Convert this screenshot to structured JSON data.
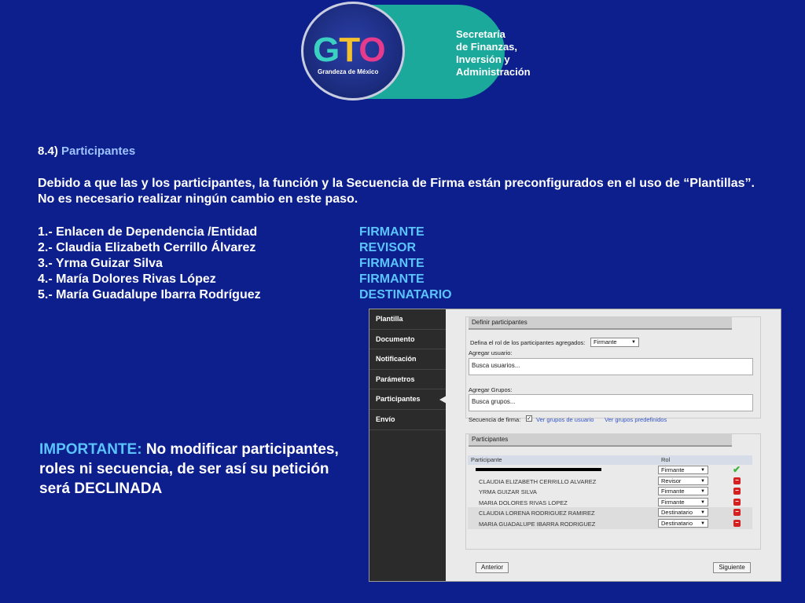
{
  "logo": {
    "mark": "GTO",
    "tagline": "Grandeza de México",
    "org_lines": [
      "Secretaría",
      "de Finanzas,",
      "Inversión y",
      "Administración"
    ]
  },
  "section": {
    "number": "8.4)",
    "title": "Participantes"
  },
  "paragraph": "Debido a que las y los participantes, la función y la Secuencia de Firma están preconfigurados en el uso de “Plantillas”. No es necesario realizar ningún cambio en este paso.",
  "participants_list": [
    {
      "name": "1.- Enlacen de Dependencia /Entidad",
      "role": "FIRMANTE"
    },
    {
      "name": "2.- Claudia Elizabeth Cerrillo Álvarez",
      "role": "REVISOR"
    },
    {
      "name": "3.- Yrma Guizar Silva",
      "role": "FIRMANTE"
    },
    {
      "name": "4.- María Dolores Rivas López",
      "role": "FIRMANTE"
    },
    {
      "name": "5.- María Guadalupe Ibarra Rodríguez",
      "role": "DESTINATARIO"
    }
  ],
  "important": {
    "label": "IMPORTANTE:",
    "text": "No modificar participantes, roles ni secuencia, de ser así su petición será DECLINADA"
  },
  "app": {
    "nav": [
      "Plantilla",
      "Documento",
      "Notificación",
      "Parámetros",
      "Participantes",
      "Envío"
    ],
    "define": {
      "title": "Definir participantes",
      "role_label": "Defina el rol de los participantes agregados:",
      "role_value": "Firmante",
      "user_label": "Agregar usuario:",
      "user_placeholder": "Busca usuarios...",
      "group_label": "Agregar Grupos:",
      "group_placeholder": "Busca grupos...",
      "sequence_label": "Secuencia de firma:",
      "link_groups": "Ver grupos de usuario",
      "link_predefined": "Ver grupos predefinidos"
    },
    "participants": {
      "title": "Participantes",
      "col_participant": "Participante",
      "col_role": "Rol",
      "rows": [
        {
          "name": "",
          "role": "Firmante",
          "action": "check"
        },
        {
          "name": "CLAUDIA ELIZABETH CERRILLO ALVAREZ",
          "role": "Revisor",
          "action": "remove"
        },
        {
          "name": "YRMA GUIZAR SILVA",
          "role": "Firmante",
          "action": "remove"
        },
        {
          "name": "MARIA DOLORES RIVAS LOPEZ",
          "role": "Firmante",
          "action": "remove"
        },
        {
          "name": "CLAUDIA LORENA RODRIGUEZ RAMIREZ",
          "role": "Destinatario",
          "action": "remove"
        },
        {
          "name": "MARIA GUADALUPE IBARRA RODRIGUEZ",
          "role": "Destinatario",
          "action": "remove"
        }
      ]
    },
    "buttons": {
      "prev": "Anterior",
      "next": "Siguiente"
    }
  }
}
